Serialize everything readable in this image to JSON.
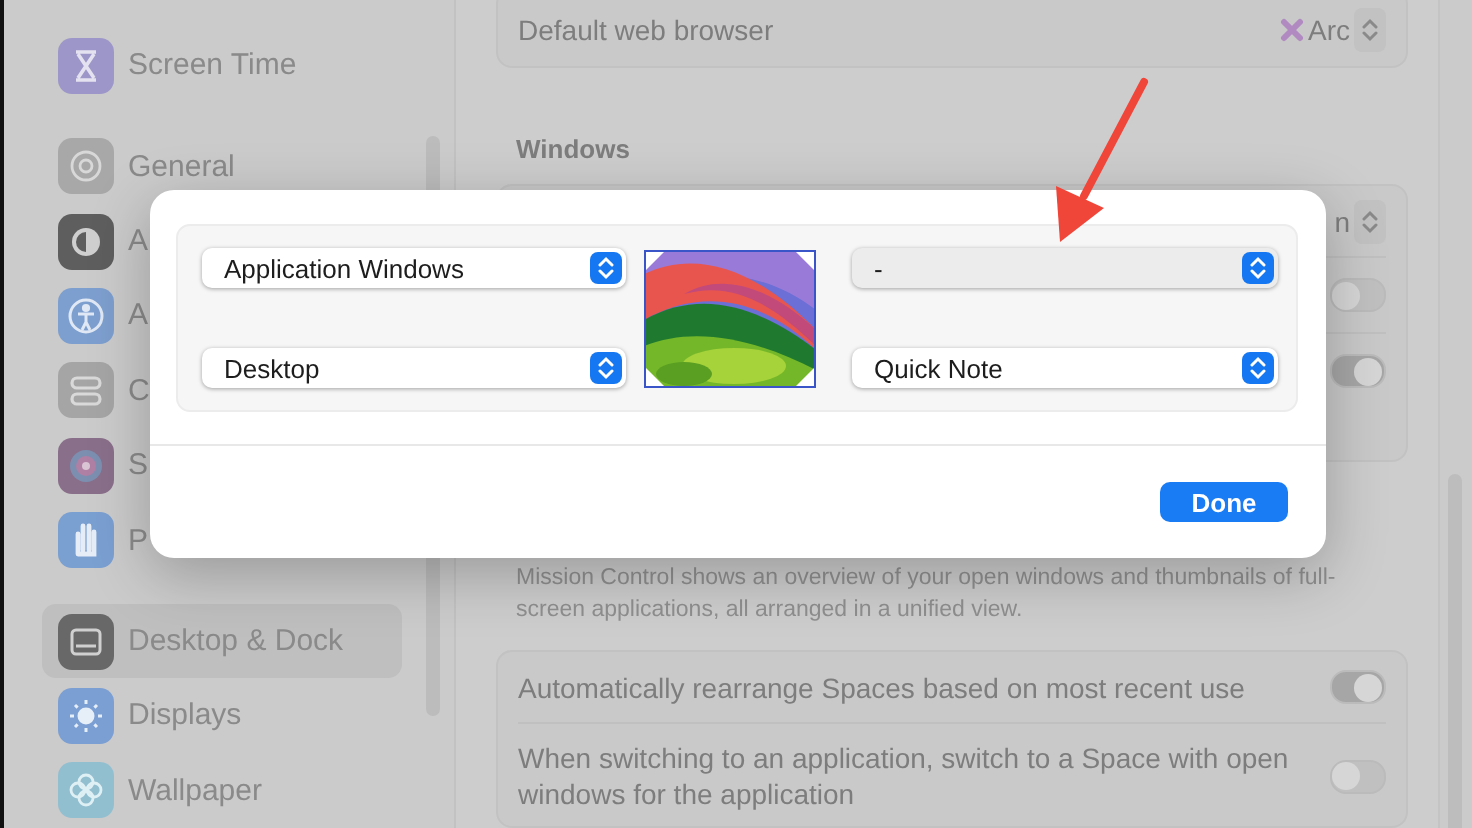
{
  "sidebar": {
    "items": [
      {
        "label": "Screen Time",
        "kind": "hourglass",
        "selected": false
      },
      {
        "label": "General",
        "kind": "gear",
        "selected": false
      },
      {
        "label": "A",
        "kind": "contrast",
        "selected": false
      },
      {
        "label": "A",
        "kind": "figure",
        "selected": false
      },
      {
        "label": "C",
        "kind": "switches",
        "selected": false
      },
      {
        "label": "S",
        "kind": "orb",
        "selected": false
      },
      {
        "label": "P",
        "kind": "hand",
        "selected": false
      },
      {
        "label": "Desktop & Dock",
        "kind": "dock",
        "selected": true
      },
      {
        "label": "Displays",
        "kind": "sun",
        "selected": false
      },
      {
        "label": "Wallpaper",
        "kind": "flower",
        "selected": false
      }
    ]
  },
  "browser_row": {
    "label": "Default web browser",
    "value": "Arc"
  },
  "windows_section": {
    "heading": "Windows",
    "value_fragment": "n",
    "toggles": [
      {
        "on": false
      },
      {
        "on": true
      }
    ]
  },
  "mission_control": {
    "description": "Mission Control shows an overview of your open windows and thumbnails of full-screen applications, all arranged in a unified view.",
    "rows": [
      {
        "label": "Automatically rearrange Spaces based on most recent use",
        "on": true
      },
      {
        "label": "When switching to an application, switch to a Space with open windows for the application",
        "on": false
      }
    ]
  },
  "dialog": {
    "left_popups": [
      "Application Windows",
      "Desktop"
    ],
    "right_popups": [
      "-",
      "Quick Note"
    ],
    "button": "Done"
  }
}
